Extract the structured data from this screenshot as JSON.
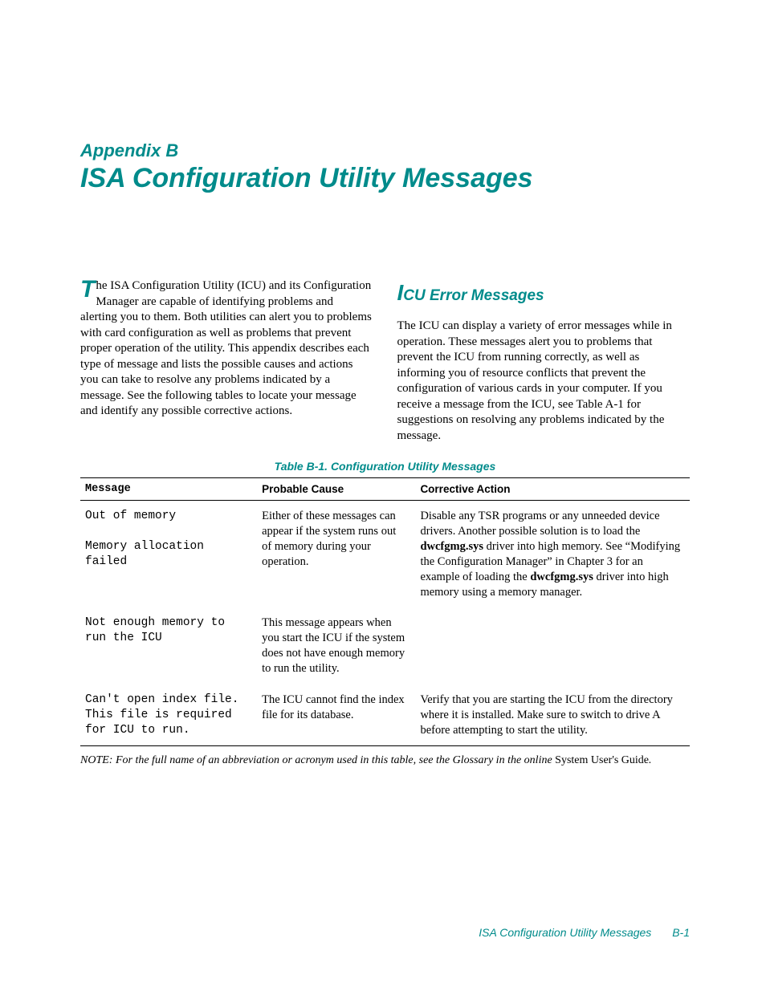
{
  "header": {
    "appendix_label": "Appendix B",
    "main_title": "ISA Configuration Utility Messages"
  },
  "intro": {
    "dropcap": "T",
    "body": "he ISA Configuration Utility (ICU) and its Configuration Manager are capable of identifying problems and alerting you to them. Both utilities can alert you to problems with card configuration as well as problems that prevent proper operation of the utility. This appendix describes each type of message and lists the possible causes and actions you can take to resolve any problems indicated by a message. See the following tables to locate your message and identify any possible corrective actions."
  },
  "section": {
    "cap": "I",
    "rest": "CU Error Messages",
    "body": "The ICU can display a variety of error messages while in operation. These messages alert you to problems that prevent the ICU from running correctly, as well as informing you of resource conflicts that prevent the configuration of various cards in your computer. If you receive a message from the ICU, see Table A-1 for suggestions on resolving any problems indicated by the message."
  },
  "table": {
    "title": "Table B-1.  Configuration Utility Messages",
    "headers": {
      "message": "Message",
      "cause": "Probable Cause",
      "action": "Corrective Action"
    },
    "rows": [
      {
        "message": "Out of memory\n\nMemory allocation failed",
        "cause": "Either of these messages can appear if the system runs out of memory during your operation.",
        "action_pre": "Disable any TSR programs or any unneeded device drivers. Another possible solution is to load the ",
        "action_bold1": "dwcfgmg.sys",
        "action_mid": " driver into high memory. See “Modifying the Configuration Manager” in Chapter 3 for an example of loading the ",
        "action_bold2": "dwcfgmg.sys",
        "action_post": " driver into high memory using a memory manager."
      },
      {
        "message": "Not enough memory to run the ICU",
        "cause": "This message appears when you start the ICU if the system does not have enough memory to run the utility.",
        "action_pre": "",
        "action_bold1": "",
        "action_mid": "",
        "action_bold2": "",
        "action_post": ""
      },
      {
        "message": "Can't open index file. This file is required for ICU to run.",
        "cause": "The ICU cannot find the index file for its database.",
        "action_pre": "Verify that you are starting the ICU from the directory where it is installed. Make sure to switch to drive A before attempting to start the utility.",
        "action_bold1": "",
        "action_mid": "",
        "action_bold2": "",
        "action_post": ""
      }
    ]
  },
  "note": {
    "prefix": "NOTE: For the full name of an abbreviation or acronym used in this table, see the Glossary in the online ",
    "guide": "System User's Guide",
    "suffix": "."
  },
  "footer": {
    "title": "ISA Configuration Utility Messages",
    "page": "B-1"
  }
}
